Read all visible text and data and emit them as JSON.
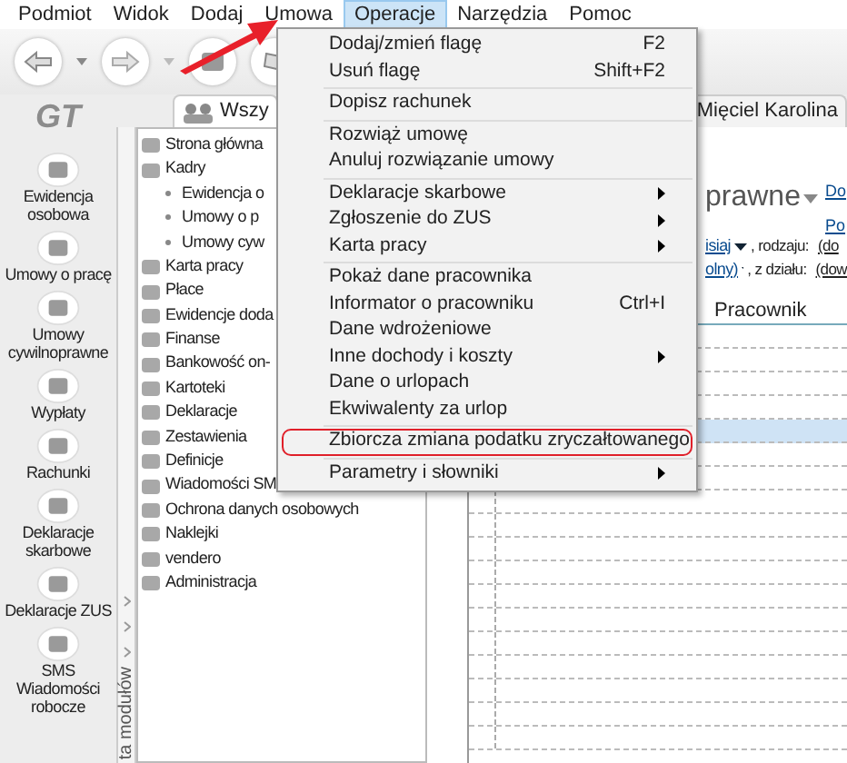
{
  "menubar": [
    {
      "label": "Podmiot",
      "selected": false
    },
    {
      "label": "Widok",
      "selected": false
    },
    {
      "label": "Dodaj",
      "selected": false
    },
    {
      "label": "Umowa",
      "selected": false
    },
    {
      "label": "Operacje",
      "selected": true
    },
    {
      "label": "Narzędzia",
      "selected": false
    },
    {
      "label": "Pomoc",
      "selected": false
    }
  ],
  "logo": "GT",
  "nav_items": [
    {
      "lines": [
        "Ewidencja",
        "osobowa"
      ]
    },
    {
      "lines": [
        "Umowy o pracę"
      ]
    },
    {
      "lines": [
        "Umowy",
        "cywilnoprawne"
      ]
    },
    {
      "lines": [
        "Wypłaty"
      ]
    },
    {
      "lines": [
        "Rachunki"
      ]
    },
    {
      "lines": [
        "Deklaracje",
        "skarbowe"
      ]
    },
    {
      "lines": [
        "Deklaracje ZUS"
      ]
    },
    {
      "lines": [
        "SMS",
        "Wiadomości",
        "robocze"
      ]
    }
  ],
  "modules_strip": {
    "label": "ta modułów"
  },
  "tree": [
    {
      "label": "Strona główna"
    },
    {
      "label": "Kadry",
      "children": [
        {
          "label": "Ewidencja o"
        },
        {
          "label": "Umowy o p"
        },
        {
          "label": "Umowy cyw"
        }
      ]
    },
    {
      "label": "Karta pracy"
    },
    {
      "label": "Płace"
    },
    {
      "label": "Ewidencje doda"
    },
    {
      "label": "Finanse"
    },
    {
      "label": "Bankowość on-"
    },
    {
      "label": "Kartoteki"
    },
    {
      "label": "Deklaracje"
    },
    {
      "label": "Zestawienia"
    },
    {
      "label": "Definicje"
    },
    {
      "label": "Wiadomości SM"
    },
    {
      "label": "Ochrona danych osobowych"
    },
    {
      "label": "Naklejki"
    },
    {
      "label": "vendero"
    },
    {
      "label": "Administracja"
    }
  ],
  "tabs": [
    {
      "label": "Wszy",
      "selected": true
    },
    {
      "label": "Mięciel Karolina",
      "selected": false
    }
  ],
  "content": {
    "heading": "prawne",
    "links": [
      "Do",
      "Po"
    ],
    "filters": [
      {
        "link": "isiaj",
        "text": ", rodzaju:",
        "value": "(do"
      },
      {
        "link": "olny)",
        "text": ", z działu:",
        "value": "(dow"
      }
    ]
  },
  "grid": {
    "columns": [
      {
        "label": "Pracownik"
      }
    ],
    "rows": [
      {
        "selected": false
      },
      {
        "selected": false
      },
      {
        "selected": false
      },
      {
        "selected": false
      },
      {
        "selected": true
      },
      {
        "selected": false
      },
      {
        "selected": false
      },
      {
        "selected": false
      },
      {
        "selected": false
      },
      {
        "selected": false
      },
      {
        "selected": false
      },
      {
        "selected": false
      },
      {
        "selected": false
      },
      {
        "selected": false
      },
      {
        "selected": false
      },
      {
        "selected": false
      },
      {
        "selected": false
      },
      {
        "selected": false
      }
    ]
  },
  "menu": {
    "items": [
      {
        "label": "Dodaj/zmień flagę",
        "shortcut": "F2"
      },
      {
        "label": "Usuń flagę",
        "shortcut": "Shift+F2"
      },
      {
        "label": "Dopisz rachunek",
        "separator_before": true
      },
      {
        "label": "Rozwiąż umowę",
        "separator_before": true
      },
      {
        "label": "Anuluj rozwiązanie umowy"
      },
      {
        "label": "Deklaracje skarbowe",
        "submenu": true,
        "separator_before": true
      },
      {
        "label": "Zgłoszenie do ZUS",
        "submenu": true
      },
      {
        "label": "Karta pracy",
        "submenu": true
      },
      {
        "label": "Pokaż dane pracownika",
        "separator_before": true
      },
      {
        "label": "Informator o pracowniku",
        "shortcut": "Ctrl+I"
      },
      {
        "label": "Dane wdrożeniowe"
      },
      {
        "label": "Inne dochody i koszty",
        "submenu": true
      },
      {
        "label": "Dane o urlopach"
      },
      {
        "label": "Ekwiwalenty za urlop"
      },
      {
        "label": "Zbiorcza zmiana podatku zryczałtowanego",
        "separator_before": true,
        "annotated": true
      },
      {
        "label": "Parametry i słowniki",
        "submenu": true,
        "separator_before": true
      }
    ]
  }
}
